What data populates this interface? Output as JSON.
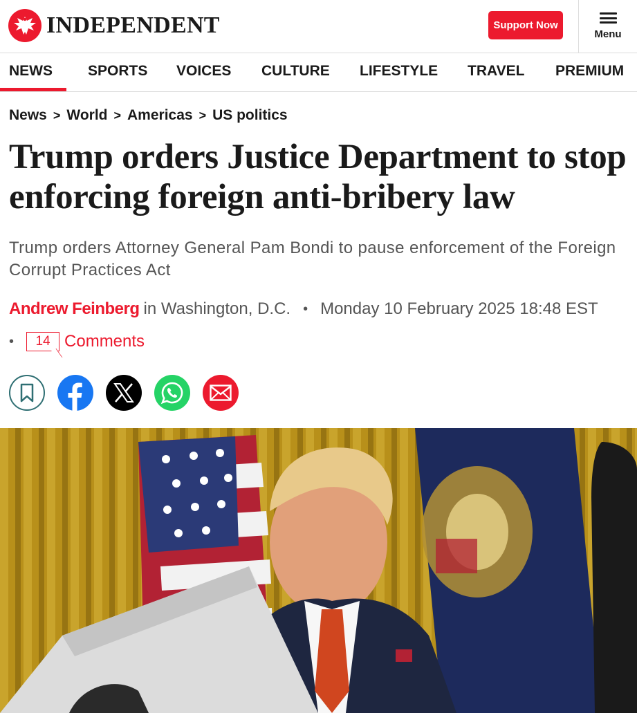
{
  "header": {
    "brand": "INDEPENDENT",
    "support_label": "Support Now",
    "menu_label": "Menu",
    "brand_color": "#ec1a2e"
  },
  "nav": {
    "items": [
      {
        "label": "NEWS",
        "active": true
      },
      {
        "label": "SPORTS"
      },
      {
        "label": "VOICES"
      },
      {
        "label": "CULTURE"
      },
      {
        "label": "LIFESTYLE"
      },
      {
        "label": "TRAVEL"
      },
      {
        "label": "PREMIUM"
      }
    ]
  },
  "breadcrumb": [
    "News",
    "World",
    "Americas",
    "US politics"
  ],
  "article": {
    "headline": "Trump orders Justice Department to stop enforcing foreign anti-bribery law",
    "standfirst": "Trump orders Attorney General Pam Bondi to pause enforcement of the Foreign Corrupt Practices Act",
    "author": "Andrew Feinberg",
    "location": "in Washington, D.C.",
    "separator": "•",
    "datetime": "Monday 10 February 2025 18:48 EST",
    "comment_count": "14",
    "comments_label": "Comments"
  },
  "share": {
    "icons": [
      "bookmark-icon",
      "facebook-icon",
      "x-icon",
      "whatsapp-icon",
      "email-icon"
    ]
  },
  "hero_image": {
    "subject": "photo"
  }
}
